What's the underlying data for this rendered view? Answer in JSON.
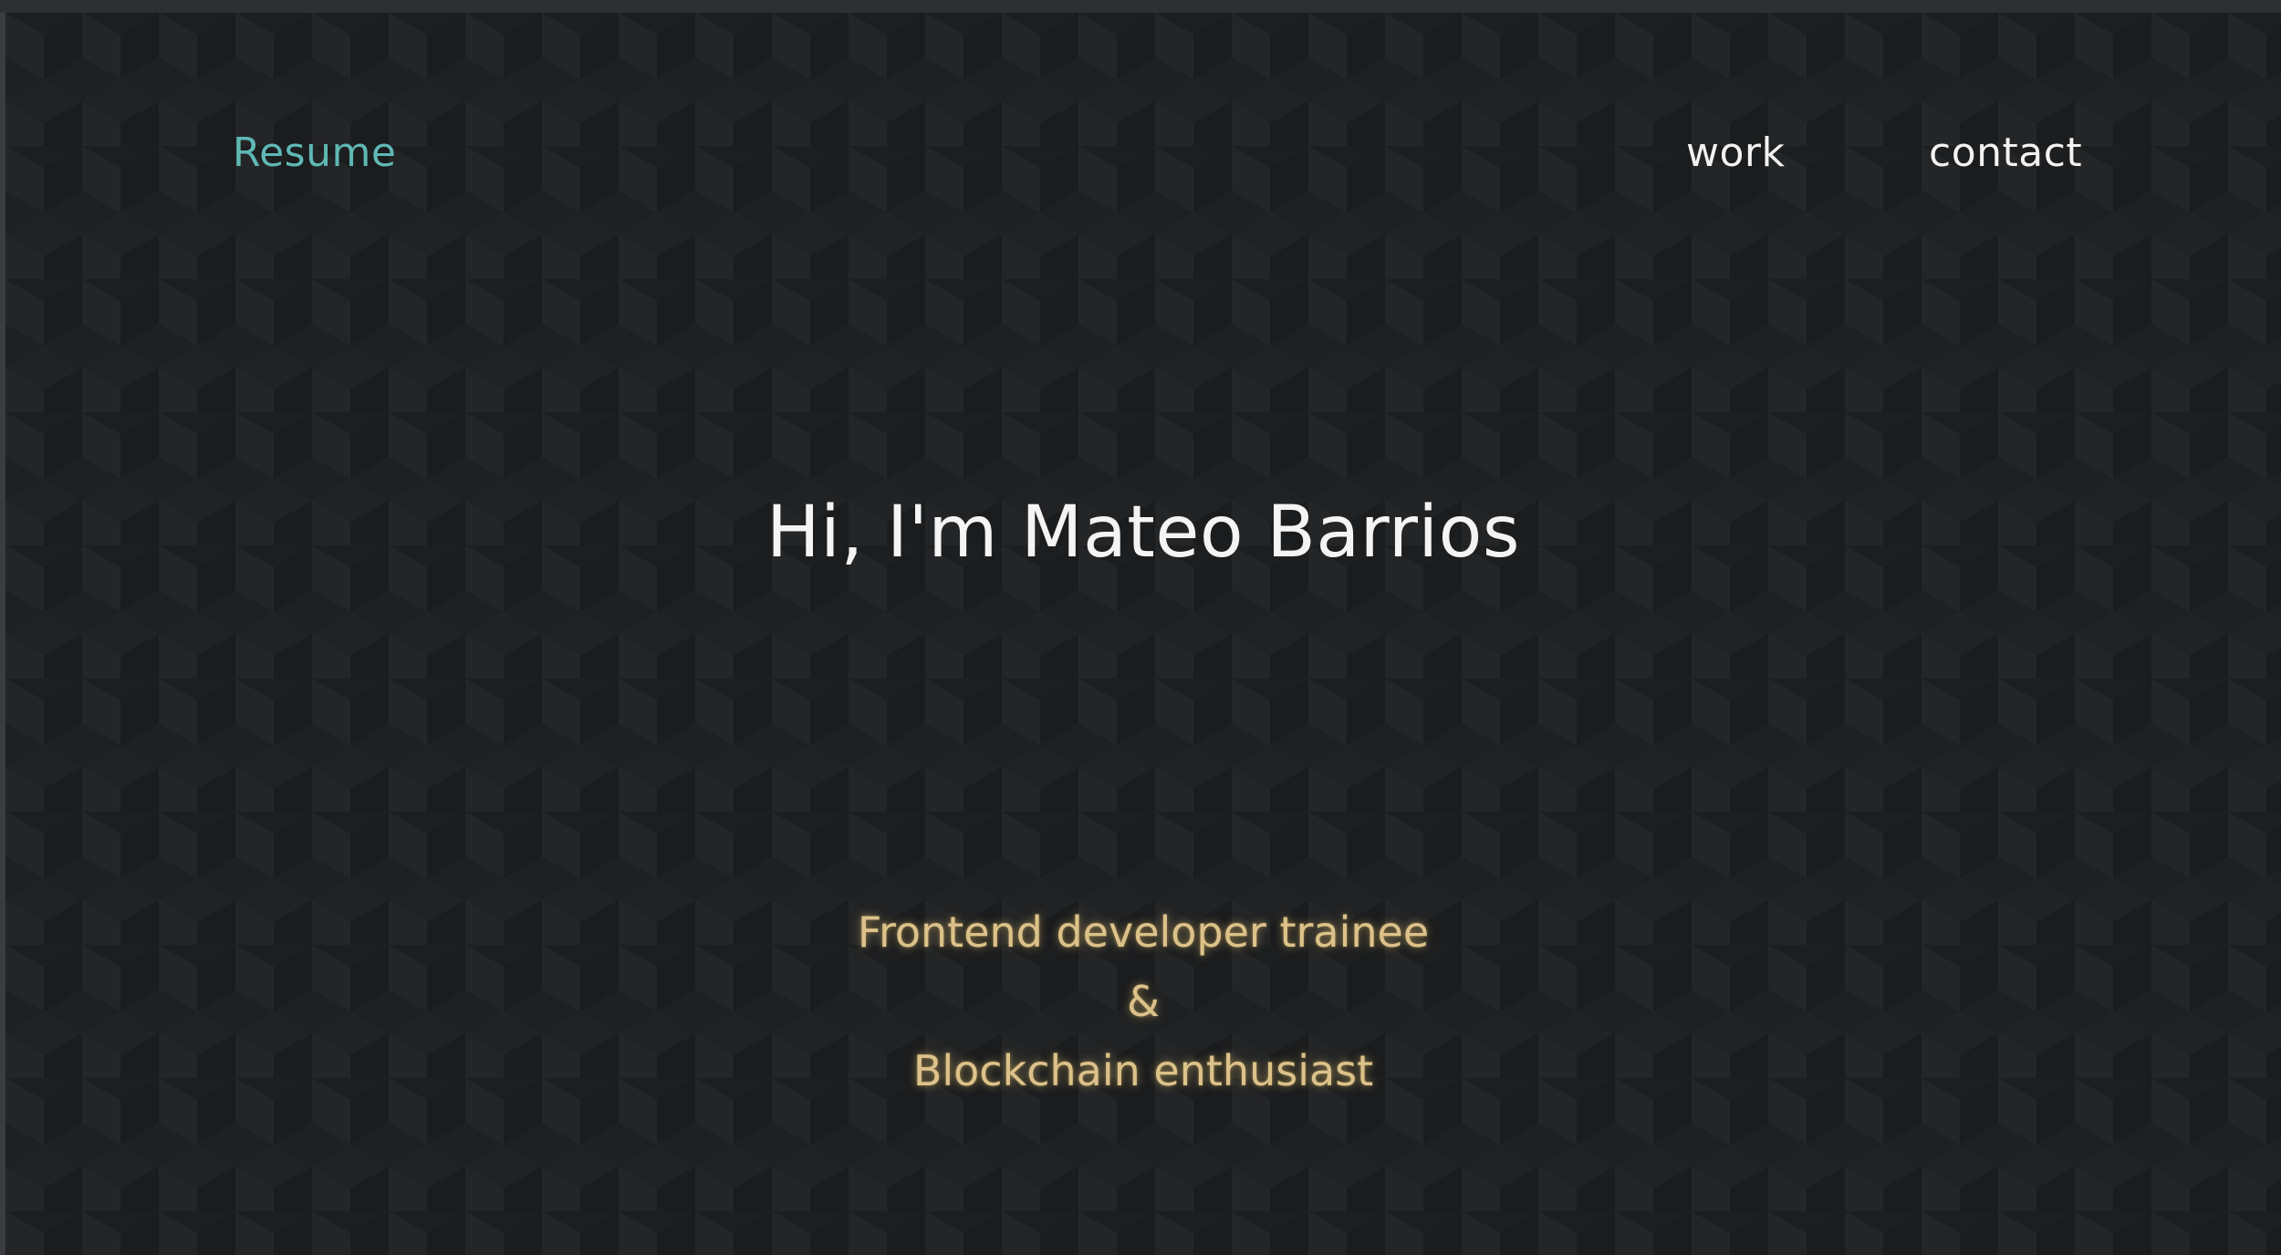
{
  "nav": {
    "resume_label": "Resume",
    "work_label": "work",
    "contact_label": "contact"
  },
  "hero": {
    "title": "Hi, I'm Mateo Barrios",
    "tagline_line1": "Frontend developer trainee",
    "tagline_line2": "&",
    "tagline_line3": "Blockchain enthusiast"
  },
  "colors": {
    "background": "#1d1f21",
    "accent": "#5fb8b4",
    "nav_text": "#f2f2f2",
    "tagline": "#dcc28a"
  }
}
